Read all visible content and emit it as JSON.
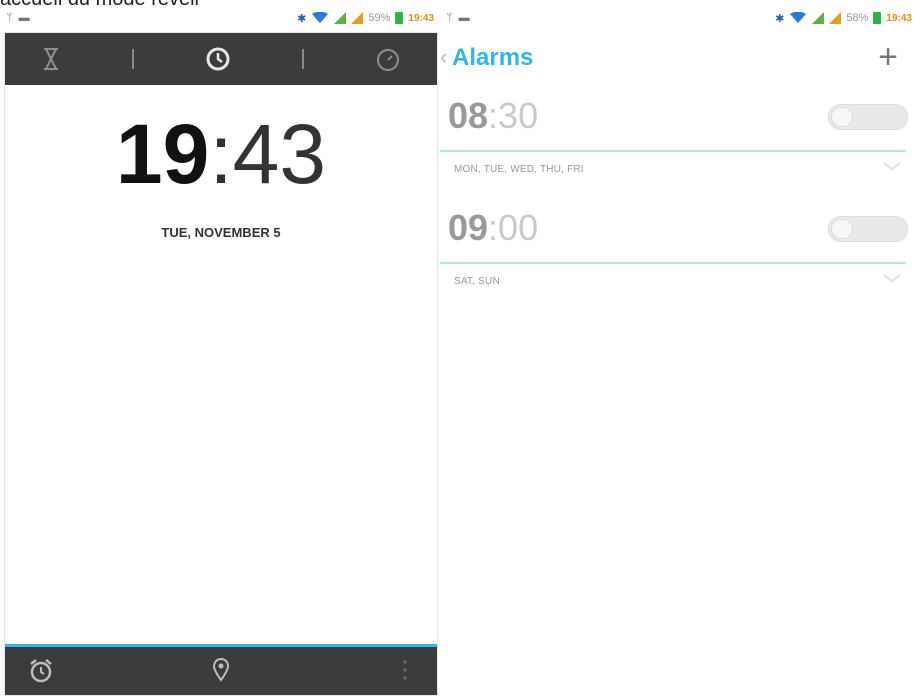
{
  "caption": "accueil du mode réveil",
  "left_screen": {
    "status_bar": {
      "battery": "59%",
      "time": "19:43"
    },
    "tabs": [
      {
        "name": "timer",
        "icon": "hourglass-icon"
      },
      {
        "name": "clock",
        "icon": "clock-icon",
        "active": true
      },
      {
        "name": "stopwatch",
        "icon": "stopwatch-icon"
      }
    ],
    "clock": {
      "hours": "19",
      "separator": ":",
      "minutes": "43"
    },
    "date": "TUE, NOVEMBER 5",
    "bottom_bar": {
      "icons": [
        "alarm-clock-icon",
        "location-pin-icon",
        "overflow-menu-icon"
      ]
    }
  },
  "right_screen": {
    "status_bar": {
      "battery": "58%",
      "time": "19:43"
    },
    "title": "Alarms",
    "add_icon": "plus-icon",
    "alarms": [
      {
        "hours": "08",
        "minutes": ":30",
        "days": "MON, TUE, WED, THU, FRI",
        "enabled": false
      },
      {
        "hours": "09",
        "minutes": ":00",
        "days": "SAT, SUN",
        "enabled": false
      }
    ]
  },
  "colors": {
    "accent": "#33b5e5",
    "bar": "#3c3c3c",
    "battery": "#2fb24a"
  }
}
